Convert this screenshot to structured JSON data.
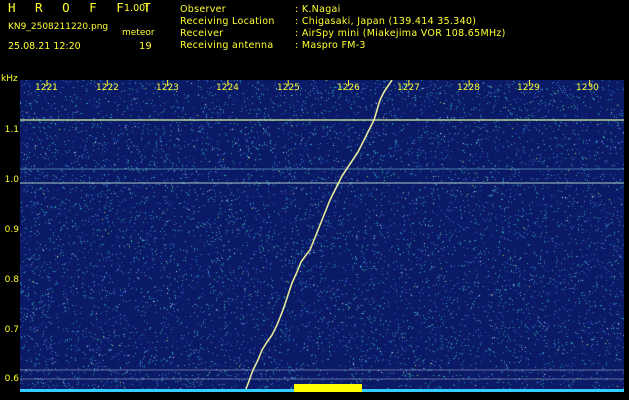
{
  "header": {
    "brand": "H R O F F T",
    "version": "1.00f",
    "filename": "KN9_2508211220.png",
    "mode": "meteor",
    "datetime": "25.08.21 12:20",
    "count": "19"
  },
  "info": [
    {
      "label": "Observer",
      "value": ": K.Nagai"
    },
    {
      "label": "Receiving Location",
      "value": ": Chigasaki, Japan (139.414 35.340)"
    },
    {
      "label": "Receiver",
      "value": ": AirSpy mini (Miakejima VOR 108.65MHz)"
    },
    {
      "label": "Receiving antenna",
      "value": ": Maspro FM-3"
    }
  ],
  "axis": {
    "y_unit": "kHz",
    "y_ticks": [
      "1.1",
      "1.0",
      "0.9",
      "0.8",
      "0.7",
      "0.6"
    ],
    "x_ticks": [
      "1221",
      "1222",
      "1223",
      "1224",
      "1225",
      "1226",
      "1227",
      "1228",
      "1229",
      "1230"
    ]
  },
  "colors": {
    "text": "#ffff33",
    "background": "#0b1a66",
    "carrier": "#d8f0a0",
    "meteor": "#e8e8a0",
    "baseline": "#33ccff",
    "peak": "#ffff00"
  }
}
